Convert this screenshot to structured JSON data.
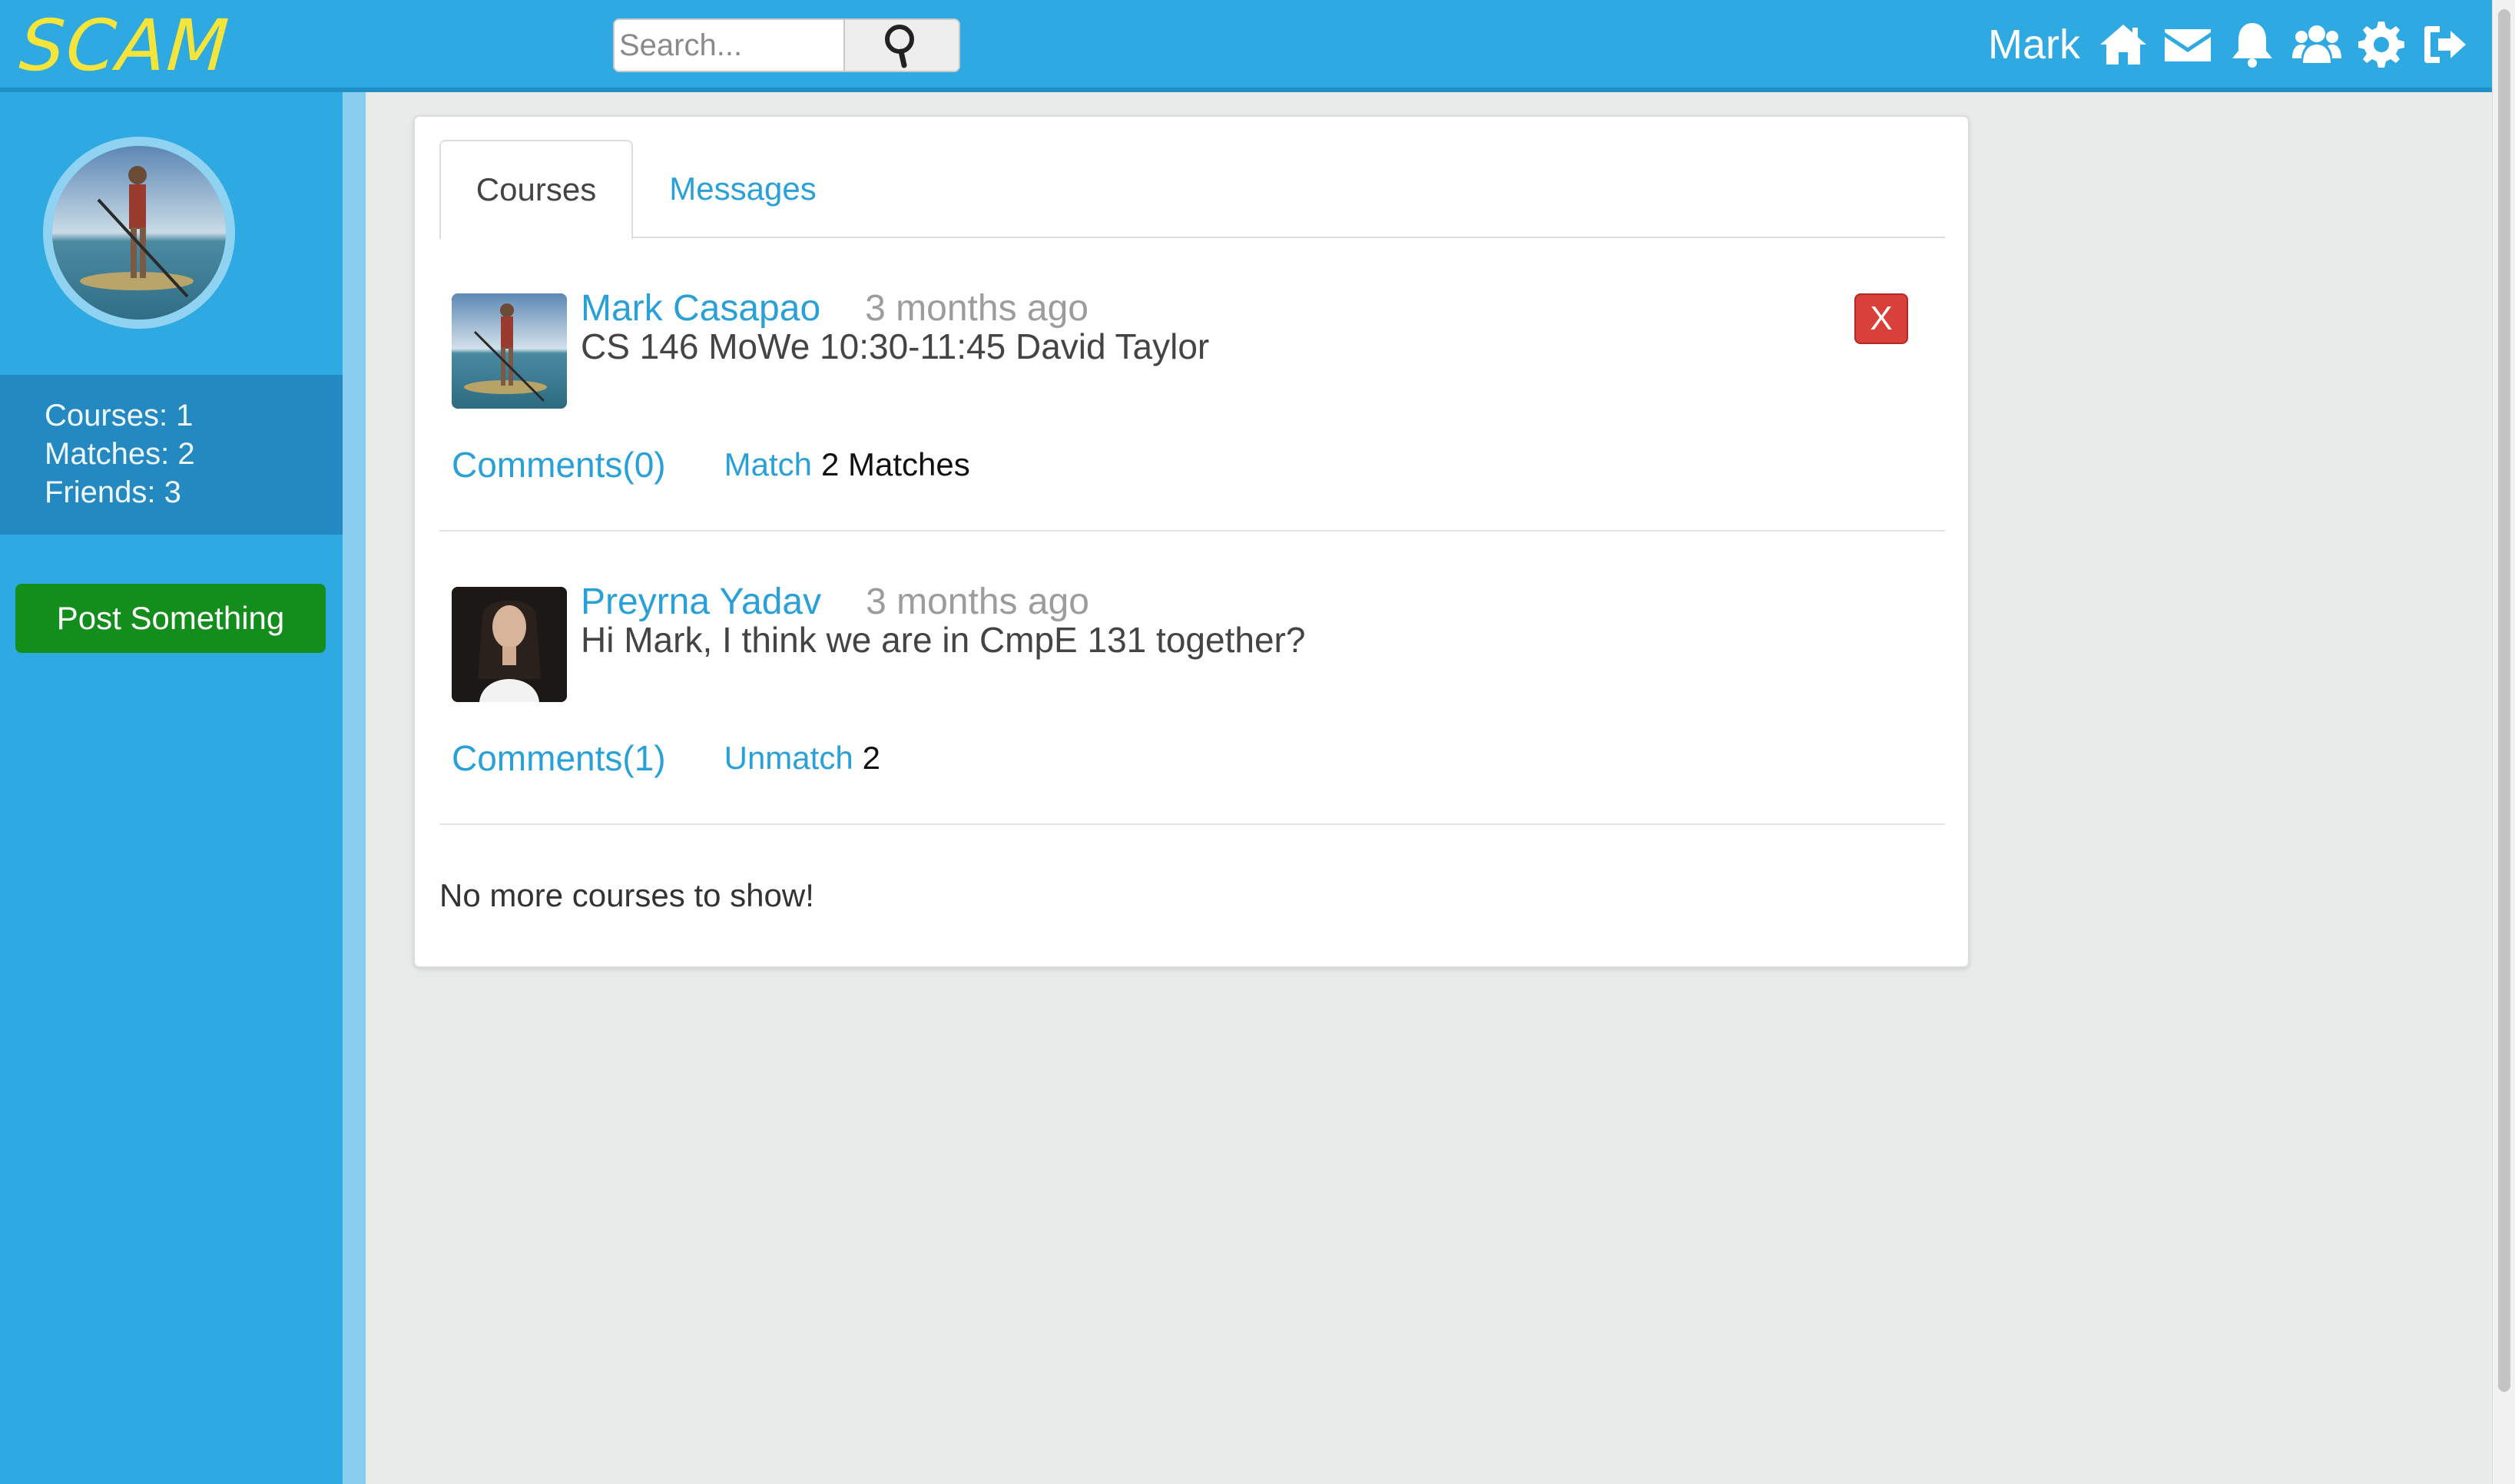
{
  "header": {
    "brand": "SCAM",
    "search_placeholder": "Search...",
    "user_name": "Mark",
    "icons": [
      "home-icon",
      "envelope-icon",
      "bell-icon",
      "users-icon",
      "gear-icon",
      "sign-out-icon"
    ]
  },
  "sidebar": {
    "courses": "Courses: 1",
    "matches": "Matches: 2",
    "friends": "Friends: 3",
    "post_button": "Post Something"
  },
  "tabs": [
    {
      "label": "Courses",
      "active": true
    },
    {
      "label": "Messages",
      "active": false
    }
  ],
  "posts": [
    {
      "author": "Mark Casapao",
      "time": "3 months ago",
      "body": "CS 146 MoWe 10:30-11:45 David Taylor",
      "comments": "Comments(0)",
      "match_label": "Match",
      "match_count": "2 Matches",
      "delete_label": "X"
    },
    {
      "author": "Preyrna Yadav",
      "time": "3 months ago",
      "body": "Hi Mark, I think we are in CmpE 131 together?",
      "comments": "Comments(1)",
      "match_label": "Unmatch",
      "match_count": "2"
    }
  ],
  "footer_note": "No more courses to show!",
  "colors": {
    "primary": "#2ea9e1",
    "brand_text": "#f5e53b",
    "post_button": "#138d1c",
    "link": "#2aa0d8",
    "delete": "#d9403a"
  }
}
